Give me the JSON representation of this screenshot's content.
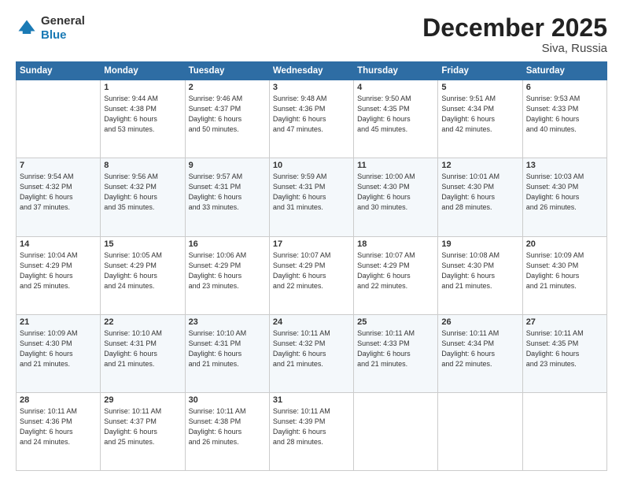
{
  "logo": {
    "general": "General",
    "blue": "Blue"
  },
  "header": {
    "month": "December 2025",
    "location": "Siva, Russia"
  },
  "weekdays": [
    "Sunday",
    "Monday",
    "Tuesday",
    "Wednesday",
    "Thursday",
    "Friday",
    "Saturday"
  ],
  "weeks": [
    [
      {
        "day": "",
        "info": ""
      },
      {
        "day": "1",
        "info": "Sunrise: 9:44 AM\nSunset: 4:38 PM\nDaylight: 6 hours\nand 53 minutes."
      },
      {
        "day": "2",
        "info": "Sunrise: 9:46 AM\nSunset: 4:37 PM\nDaylight: 6 hours\nand 50 minutes."
      },
      {
        "day": "3",
        "info": "Sunrise: 9:48 AM\nSunset: 4:36 PM\nDaylight: 6 hours\nand 47 minutes."
      },
      {
        "day": "4",
        "info": "Sunrise: 9:50 AM\nSunset: 4:35 PM\nDaylight: 6 hours\nand 45 minutes."
      },
      {
        "day": "5",
        "info": "Sunrise: 9:51 AM\nSunset: 4:34 PM\nDaylight: 6 hours\nand 42 minutes."
      },
      {
        "day": "6",
        "info": "Sunrise: 9:53 AM\nSunset: 4:33 PM\nDaylight: 6 hours\nand 40 minutes."
      }
    ],
    [
      {
        "day": "7",
        "info": "Sunrise: 9:54 AM\nSunset: 4:32 PM\nDaylight: 6 hours\nand 37 minutes."
      },
      {
        "day": "8",
        "info": "Sunrise: 9:56 AM\nSunset: 4:32 PM\nDaylight: 6 hours\nand 35 minutes."
      },
      {
        "day": "9",
        "info": "Sunrise: 9:57 AM\nSunset: 4:31 PM\nDaylight: 6 hours\nand 33 minutes."
      },
      {
        "day": "10",
        "info": "Sunrise: 9:59 AM\nSunset: 4:31 PM\nDaylight: 6 hours\nand 31 minutes."
      },
      {
        "day": "11",
        "info": "Sunrise: 10:00 AM\nSunset: 4:30 PM\nDaylight: 6 hours\nand 30 minutes."
      },
      {
        "day": "12",
        "info": "Sunrise: 10:01 AM\nSunset: 4:30 PM\nDaylight: 6 hours\nand 28 minutes."
      },
      {
        "day": "13",
        "info": "Sunrise: 10:03 AM\nSunset: 4:30 PM\nDaylight: 6 hours\nand 26 minutes."
      }
    ],
    [
      {
        "day": "14",
        "info": "Sunrise: 10:04 AM\nSunset: 4:29 PM\nDaylight: 6 hours\nand 25 minutes."
      },
      {
        "day": "15",
        "info": "Sunrise: 10:05 AM\nSunset: 4:29 PM\nDaylight: 6 hours\nand 24 minutes."
      },
      {
        "day": "16",
        "info": "Sunrise: 10:06 AM\nSunset: 4:29 PM\nDaylight: 6 hours\nand 23 minutes."
      },
      {
        "day": "17",
        "info": "Sunrise: 10:07 AM\nSunset: 4:29 PM\nDaylight: 6 hours\nand 22 minutes."
      },
      {
        "day": "18",
        "info": "Sunrise: 10:07 AM\nSunset: 4:29 PM\nDaylight: 6 hours\nand 22 minutes."
      },
      {
        "day": "19",
        "info": "Sunrise: 10:08 AM\nSunset: 4:30 PM\nDaylight: 6 hours\nand 21 minutes."
      },
      {
        "day": "20",
        "info": "Sunrise: 10:09 AM\nSunset: 4:30 PM\nDaylight: 6 hours\nand 21 minutes."
      }
    ],
    [
      {
        "day": "21",
        "info": "Sunrise: 10:09 AM\nSunset: 4:30 PM\nDaylight: 6 hours\nand 21 minutes."
      },
      {
        "day": "22",
        "info": "Sunrise: 10:10 AM\nSunset: 4:31 PM\nDaylight: 6 hours\nand 21 minutes."
      },
      {
        "day": "23",
        "info": "Sunrise: 10:10 AM\nSunset: 4:31 PM\nDaylight: 6 hours\nand 21 minutes."
      },
      {
        "day": "24",
        "info": "Sunrise: 10:11 AM\nSunset: 4:32 PM\nDaylight: 6 hours\nand 21 minutes."
      },
      {
        "day": "25",
        "info": "Sunrise: 10:11 AM\nSunset: 4:33 PM\nDaylight: 6 hours\nand 21 minutes."
      },
      {
        "day": "26",
        "info": "Sunrise: 10:11 AM\nSunset: 4:34 PM\nDaylight: 6 hours\nand 22 minutes."
      },
      {
        "day": "27",
        "info": "Sunrise: 10:11 AM\nSunset: 4:35 PM\nDaylight: 6 hours\nand 23 minutes."
      }
    ],
    [
      {
        "day": "28",
        "info": "Sunrise: 10:11 AM\nSunset: 4:36 PM\nDaylight: 6 hours\nand 24 minutes."
      },
      {
        "day": "29",
        "info": "Sunrise: 10:11 AM\nSunset: 4:37 PM\nDaylight: 6 hours\nand 25 minutes."
      },
      {
        "day": "30",
        "info": "Sunrise: 10:11 AM\nSunset: 4:38 PM\nDaylight: 6 hours\nand 26 minutes."
      },
      {
        "day": "31",
        "info": "Sunrise: 10:11 AM\nSunset: 4:39 PM\nDaylight: 6 hours\nand 28 minutes."
      },
      {
        "day": "",
        "info": ""
      },
      {
        "day": "",
        "info": ""
      },
      {
        "day": "",
        "info": ""
      }
    ]
  ]
}
